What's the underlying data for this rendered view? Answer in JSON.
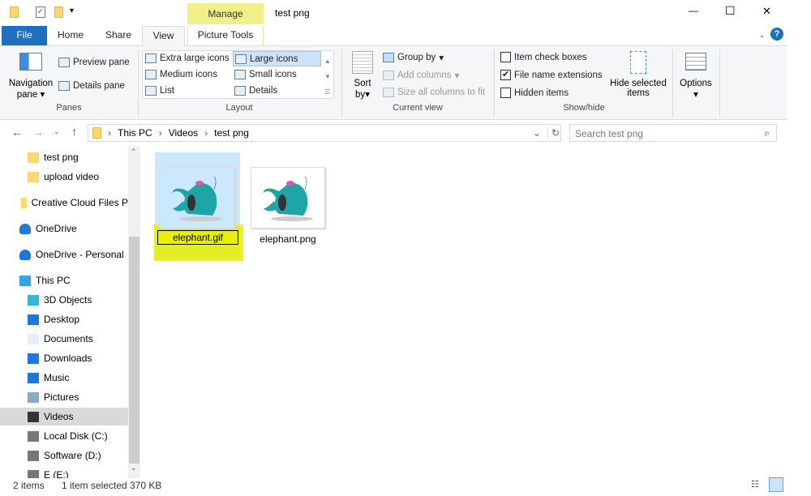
{
  "window": {
    "title": "test png",
    "manage_label": "Manage",
    "minimize": "—",
    "maximize": "☐",
    "close": "✕",
    "accent": "#1e6fbf",
    "manage_color": "#f0ef8a"
  },
  "tabs": [
    {
      "label": "File"
    },
    {
      "label": "Home"
    },
    {
      "label": "Share"
    },
    {
      "label": "View"
    },
    {
      "label": "Picture Tools"
    }
  ],
  "ribbon": {
    "panes": {
      "nav": "Navigation",
      "nav2": "pane",
      "preview": "Preview pane",
      "details": "Details pane",
      "group": "Panes"
    },
    "layout": {
      "items": [
        "Extra large icons",
        "Large icons",
        "Medium icons",
        "Small icons",
        "List",
        "Details"
      ],
      "selected": "Large icons",
      "group": "Layout"
    },
    "current_view": {
      "sort": "Sort",
      "sort2": "by",
      "group_by": "Group by",
      "add_columns": "Add columns",
      "size_columns": "Size all columns to fit",
      "group": "Current view"
    },
    "show_hide": {
      "item_check_boxes": {
        "label": "Item check boxes",
        "checked": false
      },
      "file_name_extensions": {
        "label": "File name extensions",
        "checked": true
      },
      "hidden_items": {
        "label": "Hidden items",
        "checked": false
      },
      "hide_selected": "Hide selected",
      "hide_selected2": "items",
      "group": "Show/hide"
    },
    "options": "Options"
  },
  "address": {
    "path": [
      "This PC",
      "Videos",
      "test png"
    ],
    "search_placeholder": "Search test png"
  },
  "nav": [
    {
      "label": "test png",
      "icon": "folder-icon"
    },
    {
      "label": "upload video",
      "icon": "folder-icon"
    },
    {
      "label": "Creative Cloud Files P",
      "icon": "folder-icon"
    },
    {
      "label": "OneDrive",
      "icon": "cloud-icon"
    },
    {
      "label": "OneDrive - Personal",
      "icon": "cloud-icon"
    },
    {
      "label": "This PC",
      "icon": "computer-icon"
    },
    {
      "label": "3D Objects",
      "icon": "cube-icon"
    },
    {
      "label": "Desktop",
      "icon": "desktop-icon"
    },
    {
      "label": "Documents",
      "icon": "document-icon"
    },
    {
      "label": "Downloads",
      "icon": "download-icon"
    },
    {
      "label": "Music",
      "icon": "music-icon"
    },
    {
      "label": "Pictures",
      "icon": "picture-icon"
    },
    {
      "label": "Videos",
      "icon": "video-icon",
      "selected": true
    },
    {
      "label": "Local Disk (C:)",
      "icon": "drive-icon"
    },
    {
      "label": "Software (D:)",
      "icon": "drive-icon"
    },
    {
      "label": "E (E:)",
      "icon": "drive-icon"
    }
  ],
  "files": [
    {
      "name": "elephant.gif",
      "renaming": true
    },
    {
      "name": "elephant.png"
    }
  ],
  "status": {
    "items": "2 items",
    "selected": "1 item selected",
    "size": "370 KB"
  }
}
